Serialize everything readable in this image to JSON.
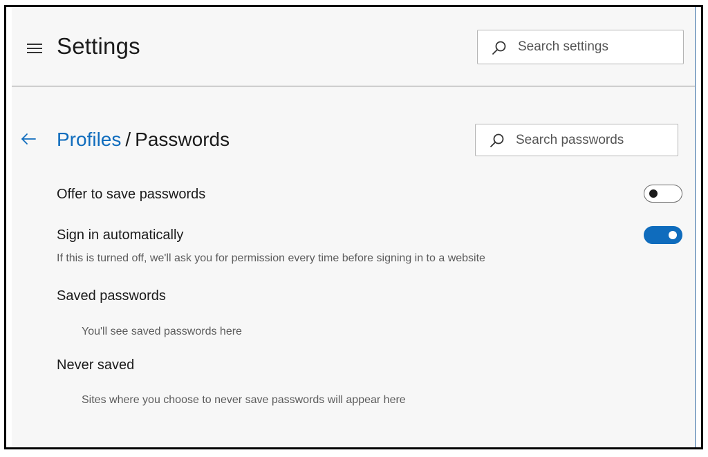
{
  "header": {
    "title": "Settings",
    "search_placeholder": "Search settings"
  },
  "breadcrumb": {
    "parent": "Profiles",
    "separator": "/",
    "current": "Passwords"
  },
  "password_search": {
    "placeholder": "Search passwords"
  },
  "settings_rows": {
    "offer_to_save": {
      "title": "Offer to save passwords",
      "enabled": false
    },
    "sign_in_automatically": {
      "title": "Sign in automatically",
      "description": "If this is turned off, we'll ask you for permission every time before signing in to a website",
      "enabled": true
    }
  },
  "sections": {
    "saved_passwords": {
      "title": "Saved passwords",
      "empty_message": "You'll see saved passwords here"
    },
    "never_saved": {
      "title": "Never saved",
      "empty_message": "Sites where you choose to never save passwords will appear here"
    }
  },
  "colors": {
    "accent": "#0f6cbd",
    "background": "#f7f7f7",
    "text": "#1b1b1b",
    "secondary_text": "#5c5c5c"
  },
  "icons": {
    "menu": "hamburger-menu-icon",
    "search": "search-icon",
    "back": "back-arrow-icon"
  }
}
